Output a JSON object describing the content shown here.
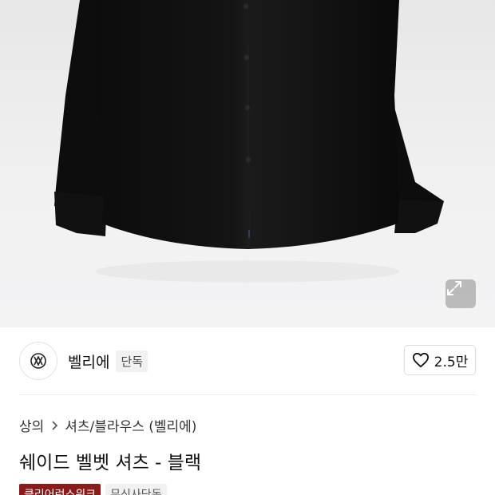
{
  "hero": {
    "image": "black-velvet-shirt-photo",
    "expand_icon": "expand-arrows-icon"
  },
  "brand": {
    "name": "벨리에",
    "badge": "단독",
    "logo_icon": "brand-logo-icon"
  },
  "like": {
    "icon": "heart-outline-icon",
    "count": "2.5만"
  },
  "breadcrumb": {
    "items": [
      "상의",
      "셔츠/블라우스 (벨리에)"
    ],
    "separator_icon": "chevron-right-icon"
  },
  "product": {
    "title": "쉐이드 벨벳 셔츠 - 블랙"
  },
  "tags": [
    "클리어런스위크",
    "무신사단독"
  ],
  "colors": {
    "tag_red": "#8b1a1a",
    "hero_bg": "#ececed"
  }
}
